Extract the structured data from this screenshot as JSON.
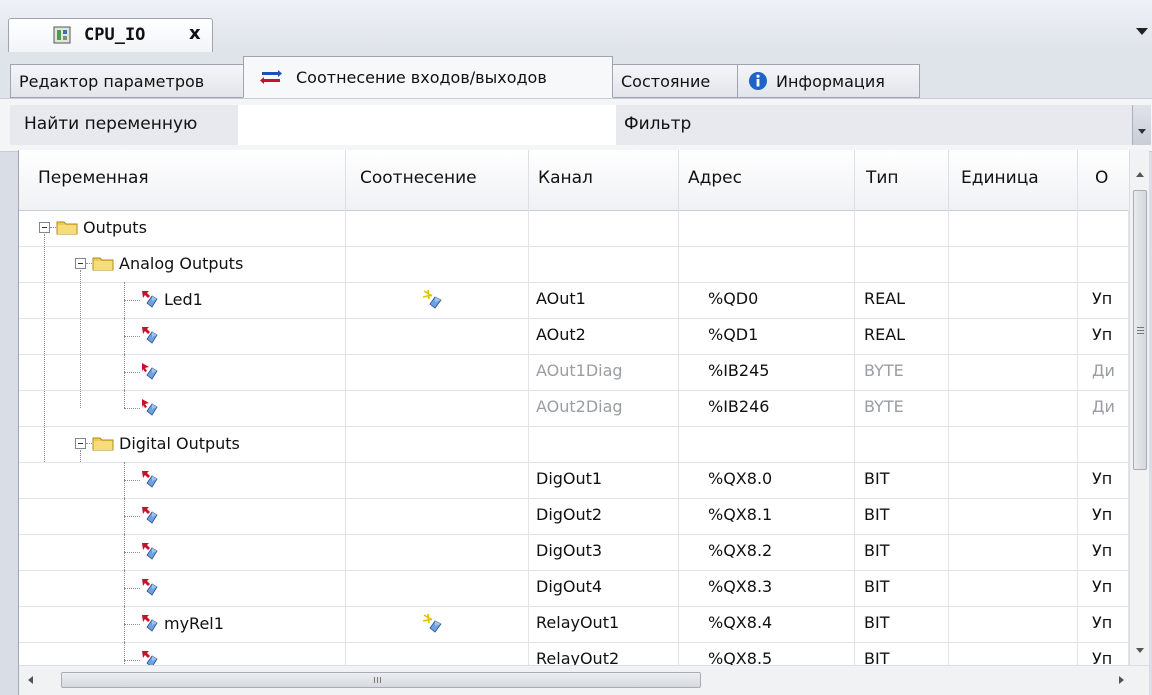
{
  "document_tab": {
    "title": "CPU_IO",
    "close_glyph": "x"
  },
  "editor_tabs": [
    {
      "label": "Редактор параметров",
      "icon": ""
    },
    {
      "label": "Соотнесение входов/выходов",
      "icon": "io-mapping-icon"
    },
    {
      "label": "Состояние",
      "icon": ""
    },
    {
      "label": "Информация",
      "icon": "info-icon"
    }
  ],
  "active_tab": 1,
  "filter_bar": {
    "find_label": "Найти переменную",
    "find_value": "",
    "filter_label": "Фильтр"
  },
  "columns": [
    "Переменная",
    "Соотнесение",
    "Канал",
    "Адрес",
    "Тип",
    "Единица",
    "О"
  ],
  "rows": [
    {
      "kind": "folder",
      "depth": 0,
      "name": "Outputs"
    },
    {
      "kind": "folder",
      "depth": 1,
      "name": "Analog Outputs"
    },
    {
      "kind": "var",
      "variable": "Led1",
      "mapped": true,
      "channel": "AOut1",
      "address": "%QD0",
      "type": "REAL",
      "unit": "",
      "desc": "Уп",
      "dim": false,
      "dir": "out"
    },
    {
      "kind": "var",
      "variable": "",
      "mapped": false,
      "channel": "AOut2",
      "address": "%QD1",
      "type": "REAL",
      "unit": "",
      "desc": "Уп",
      "dim": false,
      "dir": "out"
    },
    {
      "kind": "var",
      "variable": "",
      "mapped": false,
      "channel": "AOut1Diag",
      "address": "%IB245",
      "type": "BYTE",
      "unit": "",
      "desc": "Ди",
      "dim": true,
      "dir": "in"
    },
    {
      "kind": "var",
      "variable": "",
      "mapped": false,
      "channel": "AOut2Diag",
      "address": "%IB246",
      "type": "BYTE",
      "unit": "",
      "desc": "Ди",
      "dim": true,
      "dir": "in",
      "last": true
    },
    {
      "kind": "folder",
      "depth": 1,
      "name": "Digital Outputs"
    },
    {
      "kind": "var",
      "variable": "",
      "mapped": false,
      "channel": "DigOut1",
      "address": "%QX8.0",
      "type": "BIT",
      "unit": "",
      "desc": "Уп",
      "dim": false,
      "dir": "out"
    },
    {
      "kind": "var",
      "variable": "",
      "mapped": false,
      "channel": "DigOut2",
      "address": "%QX8.1",
      "type": "BIT",
      "unit": "",
      "desc": "Уп",
      "dim": false,
      "dir": "out"
    },
    {
      "kind": "var",
      "variable": "",
      "mapped": false,
      "channel": "DigOut3",
      "address": "%QX8.2",
      "type": "BIT",
      "unit": "",
      "desc": "Уп",
      "dim": false,
      "dir": "out"
    },
    {
      "kind": "var",
      "variable": "",
      "mapped": false,
      "channel": "DigOut4",
      "address": "%QX8.3",
      "type": "BIT",
      "unit": "",
      "desc": "Уп",
      "dim": false,
      "dir": "out"
    },
    {
      "kind": "var",
      "variable": "myRel1",
      "mapped": true,
      "channel": "RelayOut1",
      "address": "%QX8.4",
      "type": "BIT",
      "unit": "",
      "desc": "Уп",
      "dim": false,
      "dir": "out"
    },
    {
      "kind": "var",
      "variable": "",
      "mapped": false,
      "channel": "RelayOut2",
      "address": "%QX8.5",
      "type": "BIT",
      "unit": "",
      "desc": "Уп",
      "dim": false,
      "dir": "out"
    }
  ],
  "colors": {
    "accent_red": "#c8102e",
    "folder_yellow": "#f2c94c",
    "info_blue": "#1f63c6",
    "dim_text": "#9a9da3"
  }
}
